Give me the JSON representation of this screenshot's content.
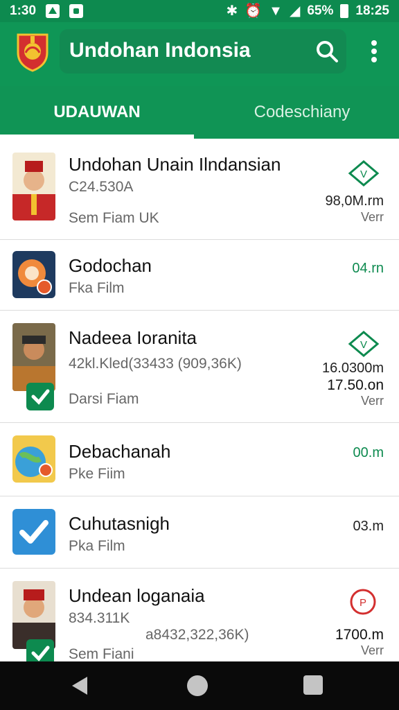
{
  "status_bar": {
    "time": "1:30",
    "battery": "65%",
    "clock_right": "18:25"
  },
  "app_bar": {
    "title": "Undohan Indonsia"
  },
  "tabs": [
    {
      "label": "UDAUWAN",
      "selected": true
    },
    {
      "label": "Codeschiany",
      "selected": false
    }
  ],
  "list": [
    {
      "title": "Undohan Unain Ilndansian",
      "line1": "C24.530A",
      "line2": "Sem Fiam UK",
      "amount": "98,0M.rm",
      "sub": "Verr",
      "badge": "v-icon"
    },
    {
      "title": "Godochan",
      "line1": "Fka Film",
      "amount": "04.rn",
      "badge": ""
    },
    {
      "title": "Nadeea Ioranita",
      "line1": "42kl.Kled(33433 (909,36K)",
      "line2": "Darsi Fiam",
      "amount": "16.0300m",
      "amount2": "17.50.on",
      "sub": "Verr",
      "badge": "v-icon"
    },
    {
      "title": "Debachanah",
      "line1": "Pke Fiim",
      "amount": "00.m",
      "badge": ""
    },
    {
      "title": "Cuhutasnigh",
      "line1": "Pka Film",
      "amount": "03.m",
      "badge": ""
    },
    {
      "title": "Undean loganaia",
      "line1": "834.311K",
      "line2": "Sem Fiani",
      "line1b": "a8432,322,36K)",
      "amount": "1700.m",
      "sub": "Verr",
      "badge": "p-icon"
    }
  ],
  "colors": {
    "brand": "#0f9656",
    "accent": "#0d8a4f",
    "danger": "#d32f2f"
  }
}
